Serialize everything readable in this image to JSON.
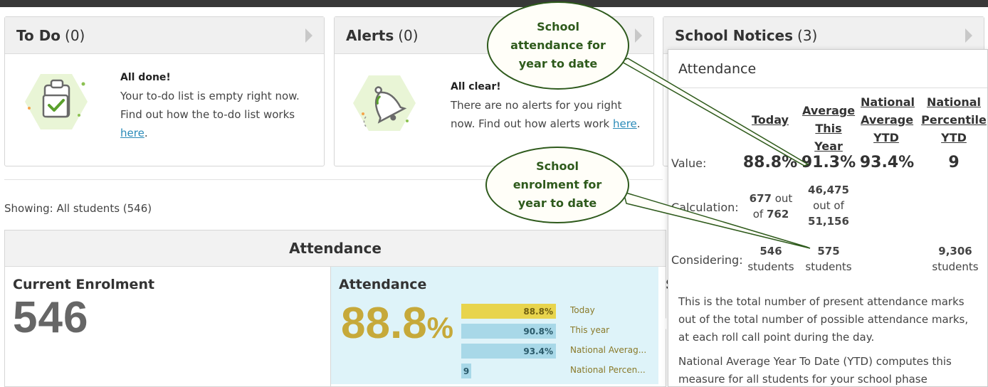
{
  "todo": {
    "title": "To Do",
    "count": "(0)",
    "heading": "All done!",
    "body": "Your to-do list is empty right now. Find out how the to-do list works",
    "link": "here",
    "tail": "."
  },
  "alerts": {
    "title": "Alerts",
    "count": "(0)",
    "heading": "All clear!",
    "body": "There are no alerts for you right now. Find out how alerts work",
    "link": "here",
    "tail": "."
  },
  "notices": {
    "title": "School Notices",
    "count": "(3)"
  },
  "showing": "Showing: All students (546)",
  "attendance_section": {
    "header": "Attendance",
    "enrolment_title": "Current Enrolment",
    "enrolment_value": "546",
    "attendance_title": "Attendance",
    "attendance_value": "88.8",
    "attendance_unit": "%",
    "bars": [
      {
        "value_text": "88.8%",
        "fraction": 1.0,
        "label": "Today",
        "color": "#e8d44d",
        "text_color": "#6f5f10"
      },
      {
        "value_text": "90.8%",
        "fraction": 1.0,
        "label": "This year",
        "color": "#a8d8e8",
        "text_color": "#2a5a6a"
      },
      {
        "value_text": "93.4%",
        "fraction": 1.0,
        "label": "National Averag...",
        "color": "#a8d8e8",
        "text_color": "#2a5a6a"
      },
      {
        "value_text": "9",
        "fraction": 0.1,
        "label": "National Percen...",
        "color": "#a8d8e8",
        "text_color": "#2a5a6a"
      }
    ],
    "partial_letter": "S"
  },
  "popup": {
    "title": "Attendance",
    "columns": [
      "Today",
      "Average This Year",
      "National Average YTD",
      "National Percentile YTD"
    ],
    "value_label": "Value:",
    "values": [
      "88.8%",
      "91.3%",
      "93.4%",
      "9"
    ],
    "calc_label": "Calculation:",
    "calc_today": {
      "num": "677",
      "mid": "out",
      "pre": "of",
      "den": "762"
    },
    "calc_year": {
      "num": "46,475",
      "mid": "out of",
      "den": "51,156"
    },
    "considering_label": "Considering:",
    "considering": {
      "today": "546",
      "year": "575",
      "percentile": "9,306",
      "unit": "students"
    },
    "desc1": "This is the total number of present attendance marks out of the total number of possible attendance marks, at each roll call point during the day.",
    "desc2": "National Average Year To Date (YTD) computes this measure for all students for your school phase"
  },
  "callouts": {
    "attendance": "School attendance for year to date",
    "enrolment": "School enrolment for year to date",
    "color": "#2e5a1c"
  },
  "colors": {
    "accent_gold": "#c6a93a",
    "attendance_bg": "#def3f9",
    "link": "#2a8ab8"
  }
}
